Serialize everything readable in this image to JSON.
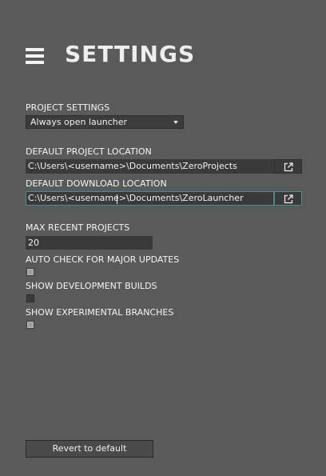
{
  "header": {
    "menu_icon": "hamburger-menu-icon",
    "title": "SETTINGS"
  },
  "project_settings": {
    "label": "PROJECT SETTINGS",
    "selected": "Always open launcher"
  },
  "project_location": {
    "label": "DEFAULT PROJECT LOCATION",
    "value": "C:\\Users\\<username>\\Documents\\ZeroProjects",
    "button_icon": "open-external-icon"
  },
  "download_location": {
    "label": "DEFAULT DOWNLOAD LOCATION",
    "value": "C:\\Users\\<username>\\Documents\\ZeroLauncher",
    "button_icon": "open-external-icon"
  },
  "max_recent": {
    "label": "MAX RECENT PROJECTS",
    "value": "20"
  },
  "auto_check": {
    "label": "AUTO CHECK FOR MAJOR UPDATES",
    "checked": true
  },
  "dev_builds": {
    "label": "SHOW DEVELOPMENT BUILDS",
    "checked": false
  },
  "experimental": {
    "label": "SHOW EXPERIMENTAL BRANCHES",
    "checked": true
  },
  "revert": {
    "label": "Revert to default"
  },
  "colors": {
    "background": "#5a5a5a",
    "field": "#3a3a3a",
    "focus_border": "#4a8a8a",
    "text": "#f0f0f0"
  }
}
